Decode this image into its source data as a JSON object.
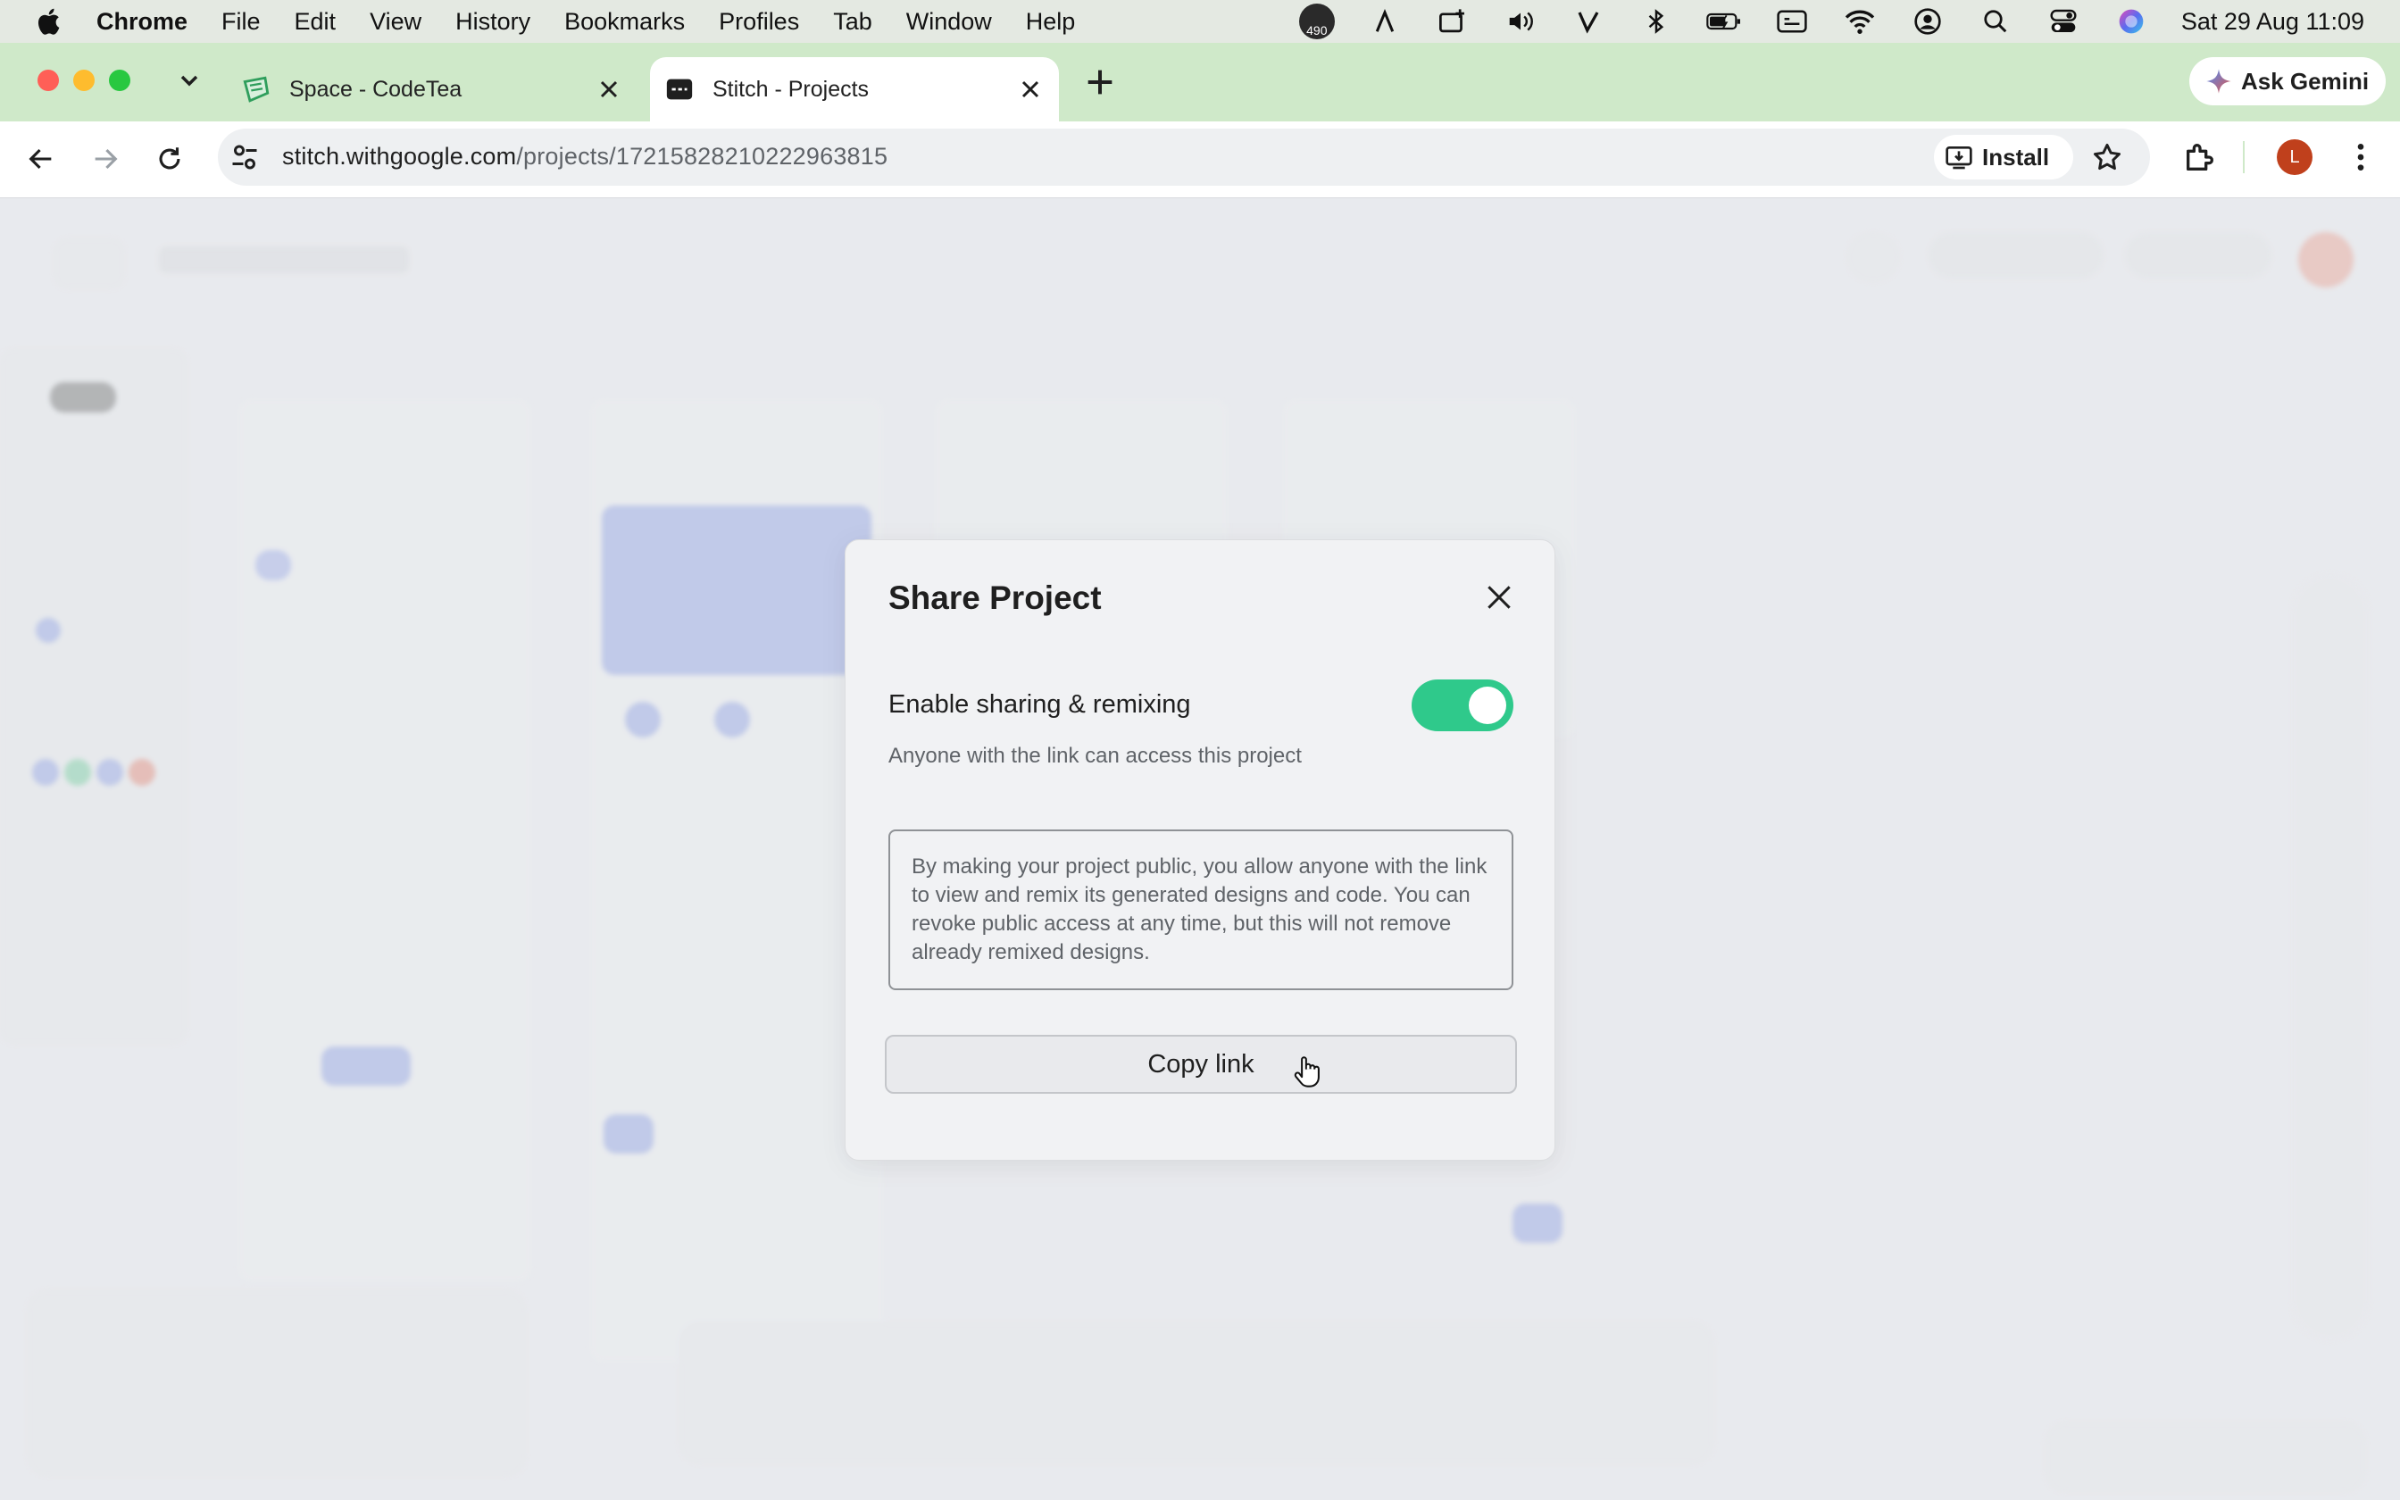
{
  "menubar": {
    "app_name": "Chrome",
    "items": [
      "File",
      "Edit",
      "View",
      "History",
      "Bookmarks",
      "Profiles",
      "Tab",
      "Window",
      "Help"
    ],
    "badge_count": "490",
    "clock": "Sat 29 Aug  11:09"
  },
  "tabs": [
    {
      "title": "Space - CodeTea",
      "icon": "codetea-icon",
      "active": false
    },
    {
      "title": "Stitch - Projects",
      "icon": "stitch-icon",
      "active": true
    }
  ],
  "gemini_label": "Ask Gemini",
  "address_bar": {
    "domain": "stitch.withgoogle.com",
    "path": "/projects/17215828210222963815"
  },
  "install_label": "Install",
  "profile_initial": "L",
  "dialog": {
    "title": "Share Project",
    "toggle_label": "Enable sharing & remixing",
    "toggle_on": true,
    "subtitle": "Anyone with the link can access this project",
    "notice": "By making your project public, you allow anyone with the link to view and remix its generated designs and code. You can revoke public access at any time, but this will not remove already remixed designs.",
    "copy_button": "Copy link"
  },
  "colors": {
    "toggle_accent": "#2fc98b",
    "tabstrip_bg": "#cfe9c9",
    "profile_bg": "#c0401c"
  }
}
